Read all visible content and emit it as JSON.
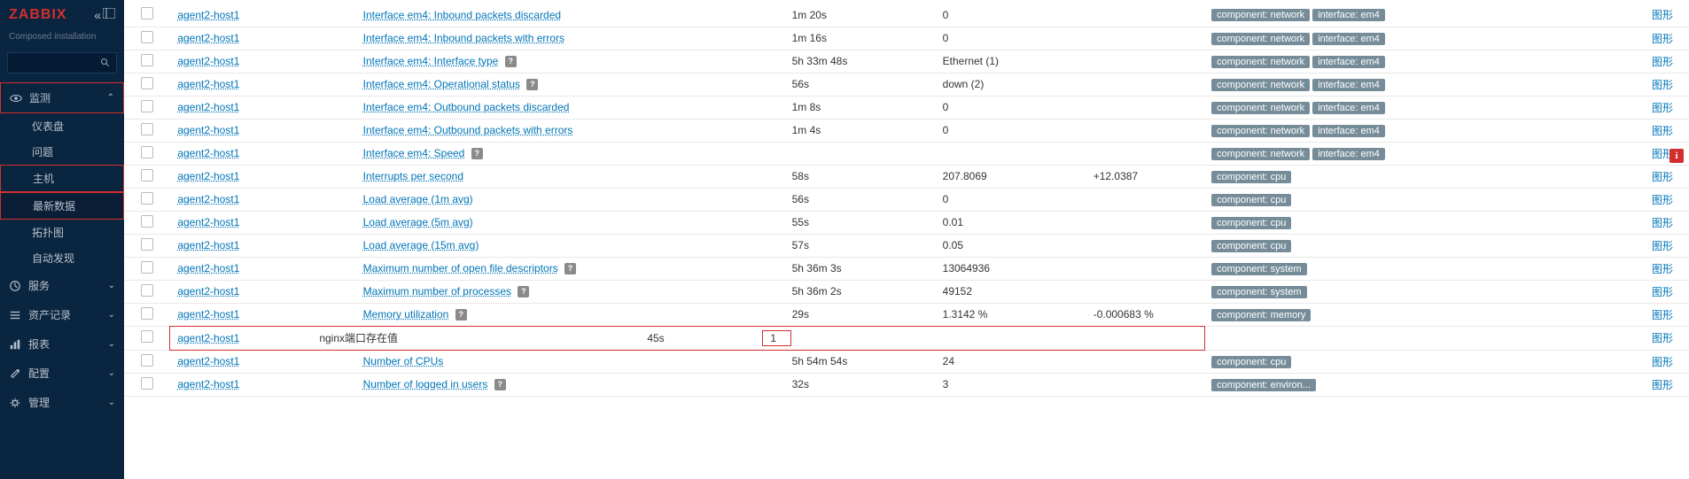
{
  "app": {
    "logo_text": "ZABBIX",
    "install_label": "Composed installation"
  },
  "nav": {
    "monitor": {
      "label": "监测",
      "expanded": true
    },
    "monitor_items": [
      {
        "label": "仪表盘",
        "key": "dashboard"
      },
      {
        "label": "问题",
        "key": "problems"
      },
      {
        "label": "主机",
        "key": "hosts",
        "boxed": true
      },
      {
        "label": "最新数据",
        "key": "latest",
        "active": true,
        "boxed": true
      },
      {
        "label": "拓扑图",
        "key": "maps"
      },
      {
        "label": "自动发现",
        "key": "discovery"
      }
    ],
    "sections": [
      {
        "label": "服务",
        "key": "services"
      },
      {
        "label": "资产记录",
        "key": "inventory"
      },
      {
        "label": "报表",
        "key": "reports"
      },
      {
        "label": "配置",
        "key": "config"
      },
      {
        "label": "管理",
        "key": "admin"
      }
    ]
  },
  "table": {
    "graph_label": "图形",
    "rows": [
      {
        "host": "agent2-host1",
        "item": "Interface em4: Inbound packets discarded",
        "help": false,
        "lastcheck": "1m 20s",
        "lastvalue": "0",
        "change": "",
        "tags": [
          "component: network",
          "interface: em4"
        ]
      },
      {
        "host": "agent2-host1",
        "item": "Interface em4: Inbound packets with errors",
        "help": false,
        "lastcheck": "1m 16s",
        "lastvalue": "0",
        "change": "",
        "tags": [
          "component: network",
          "interface: em4"
        ]
      },
      {
        "host": "agent2-host1",
        "item": "Interface em4: Interface type",
        "help": true,
        "lastcheck": "5h 33m 48s",
        "lastvalue": "Ethernet (1)",
        "change": "",
        "tags": [
          "component: network",
          "interface: em4"
        ]
      },
      {
        "host": "agent2-host1",
        "item": "Interface em4: Operational status",
        "help": true,
        "lastcheck": "56s",
        "lastvalue": "down (2)",
        "change": "",
        "tags": [
          "component: network",
          "interface: em4"
        ]
      },
      {
        "host": "agent2-host1",
        "item": "Interface em4: Outbound packets discarded",
        "help": false,
        "lastcheck": "1m 8s",
        "lastvalue": "0",
        "change": "",
        "tags": [
          "component: network",
          "interface: em4"
        ]
      },
      {
        "host": "agent2-host1",
        "item": "Interface em4: Outbound packets with errors",
        "help": false,
        "lastcheck": "1m 4s",
        "lastvalue": "0",
        "change": "",
        "tags": [
          "component: network",
          "interface: em4"
        ]
      },
      {
        "host": "agent2-host1",
        "item": "Interface em4: Speed",
        "help": true,
        "lastcheck": "",
        "lastvalue": "",
        "change": "",
        "tags": [
          "component: network",
          "interface: em4"
        ],
        "info": true
      },
      {
        "host": "agent2-host1",
        "item": "Interrupts per second",
        "help": false,
        "lastcheck": "58s",
        "lastvalue": "207.8069",
        "change": "+12.0387",
        "tags": [
          "component: cpu"
        ]
      },
      {
        "host": "agent2-host1",
        "item": "Load average (1m avg)",
        "help": false,
        "lastcheck": "56s",
        "lastvalue": "0",
        "change": "",
        "tags": [
          "component: cpu"
        ]
      },
      {
        "host": "agent2-host1",
        "item": "Load average (5m avg)",
        "help": false,
        "lastcheck": "55s",
        "lastvalue": "0.01",
        "change": "",
        "tags": [
          "component: cpu"
        ]
      },
      {
        "host": "agent2-host1",
        "item": "Load average (15m avg)",
        "help": false,
        "lastcheck": "57s",
        "lastvalue": "0.05",
        "change": "",
        "tags": [
          "component: cpu"
        ]
      },
      {
        "host": "agent2-host1",
        "item": "Maximum number of open file descriptors",
        "help": true,
        "lastcheck": "5h 36m 3s",
        "lastvalue": "13064936",
        "change": "",
        "tags": [
          "component: system"
        ]
      },
      {
        "host": "agent2-host1",
        "item": "Maximum number of processes",
        "help": true,
        "lastcheck": "5h 36m 2s",
        "lastvalue": "49152",
        "change": "",
        "tags": [
          "component: system"
        ]
      },
      {
        "host": "agent2-host1",
        "item": "Memory utilization",
        "help": true,
        "lastcheck": "29s",
        "lastvalue": "1.3142 %",
        "change": "-0.000683 %",
        "tags": [
          "component: memory"
        ]
      },
      {
        "host": "agent2-host1",
        "item": "nginx端口存在值",
        "help": false,
        "lastcheck": "45s",
        "lastvalue": "1",
        "change": "",
        "tags": [],
        "highlight": true
      },
      {
        "host": "agent2-host1",
        "item": "Number of CPUs",
        "help": false,
        "lastcheck": "5h 54m 54s",
        "lastvalue": "24",
        "change": "",
        "tags": [
          "component: cpu"
        ]
      },
      {
        "host": "agent2-host1",
        "item": "Number of logged in users",
        "help": true,
        "lastcheck": "32s",
        "lastvalue": "3",
        "change": "",
        "tags": [
          "component: environ..."
        ]
      }
    ]
  },
  "icons": {
    "help_char": "?",
    "info_char": "i"
  }
}
